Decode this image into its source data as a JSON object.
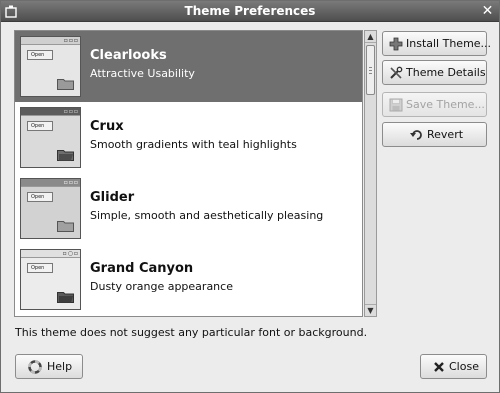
{
  "window": {
    "title": "Theme Preferences"
  },
  "themes": [
    {
      "name": "Clearlooks",
      "description": "Attractive Usability",
      "thumb_label": "Open",
      "selected": true
    },
    {
      "name": "Crux",
      "description": "Smooth gradients with teal highlights",
      "thumb_label": "Open",
      "selected": false
    },
    {
      "name": "Glider",
      "description": "Simple, smooth and aesthetically pleasing",
      "thumb_label": "Open",
      "selected": false
    },
    {
      "name": "Grand Canyon",
      "description": "Dusty orange appearance",
      "thumb_label": "Open",
      "selected": false
    }
  ],
  "buttons": {
    "install_theme": "Install Theme...",
    "theme_details": "Theme Details",
    "save_theme": "Save Theme...",
    "revert": "Revert",
    "help": "Help",
    "close": "Close"
  },
  "info_text": "This theme does not suggest any particular font or background.",
  "icons": {
    "window_menu": "window-menu-icon",
    "window_close": "close-icon",
    "install": "plus-icon",
    "details": "tools-icon",
    "save": "floppy-icon",
    "revert": "undo-arrow-icon",
    "help": "lifebuoy-icon",
    "close": "x-icon"
  }
}
